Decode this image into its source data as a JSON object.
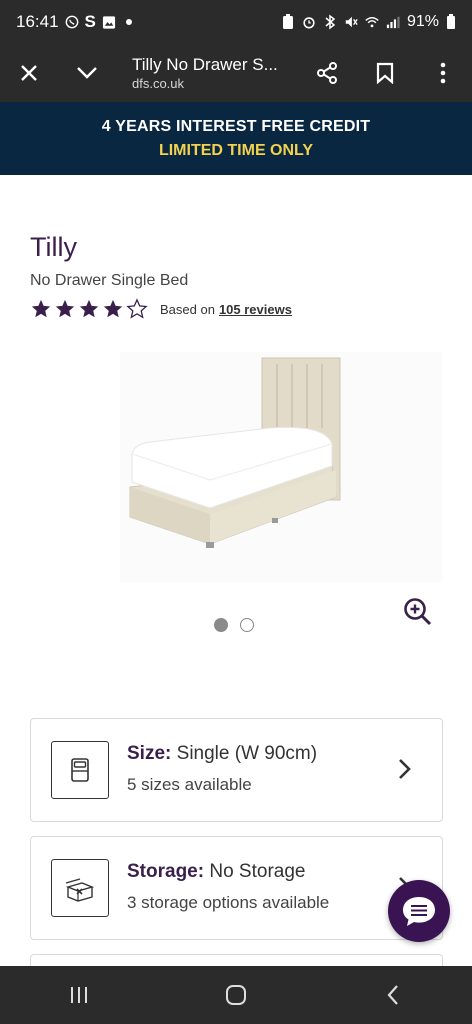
{
  "status_bar": {
    "time": "16:41",
    "s_indicator": "S",
    "battery": "91%",
    "icons": [
      "whatsapp-icon",
      "image-icon",
      "dot-icon",
      "battery-saver-icon",
      "alarm-icon",
      "bluetooth-icon",
      "mute-icon",
      "wifi-icon",
      "signal-icon"
    ]
  },
  "browser": {
    "title": "Tilly No Drawer S...",
    "domain": "dfs.co.uk",
    "icons": [
      "close-icon",
      "chevron-down-icon",
      "share-icon",
      "bookmark-icon",
      "more-icon"
    ]
  },
  "promo": {
    "line1": "4 YEARS INTEREST FREE CREDIT",
    "line2": "LIMITED TIME ONLY",
    "bg_color": "#0a2742",
    "highlight_color": "#f2d24e"
  },
  "product": {
    "name": "Tilly",
    "subtitle": "No Drawer Single Bed",
    "rating": 4,
    "rating_max": 5,
    "rating_prefix": "Based on",
    "reviews_link": "105 reviews",
    "brand_color": "#3a1f4d"
  },
  "gallery": {
    "image_count": 2,
    "active_index": 0
  },
  "options": [
    {
      "label": "Size:",
      "value": "Single (W 90cm)",
      "sub": "5 sizes available",
      "icon": "bed-size-icon"
    },
    {
      "label": "Storage:",
      "value": "No Storage",
      "sub": "3 storage options available",
      "icon": "no-storage-icon"
    }
  ],
  "nav": {
    "icons": [
      "recent-apps-icon",
      "home-icon",
      "back-icon"
    ]
  }
}
